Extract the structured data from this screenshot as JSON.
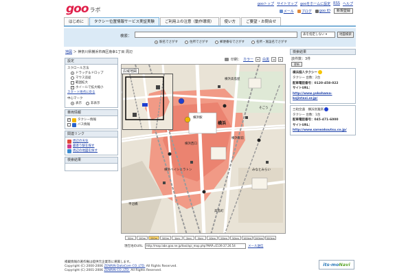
{
  "header": {
    "logo": "goo",
    "logo_sub": "ラボ",
    "top_links": [
      "gooトップ",
      "サイトマップ",
      "gooをホームに設定",
      "RSS",
      "ヘルプ"
    ],
    "tools": [
      "メール",
      "ブログ",
      "goo ID"
    ],
    "signup_label": "新規登録"
  },
  "tabs": [
    "はじめに",
    "タクシー位置情報サービス実証実験",
    "ご利用上の注意（動作環境）",
    "使い方",
    "ご要望・お問合せ"
  ],
  "search": {
    "label": "検索：",
    "value": "",
    "select_value": "表を指定しない",
    "button_label": "地図検索",
    "options": [
      "駅名でさがす",
      "住所でさがす",
      "郵便番号でさがす",
      "名所・施設名でさがす"
    ]
  },
  "breadcrumb": {
    "link": "地図",
    "sep": "＞",
    "current": "神奈川県横浜市西区南幸1丁目 周辺"
  },
  "settings": {
    "title": "設定",
    "scroll_method": "スクロール方法",
    "scroll_options": [
      "ドラッグ＆ドロップ",
      "マウス追従"
    ],
    "zoom_options": [
      "範囲拡大",
      "ホイールで拡大縮小"
    ],
    "start_link": "スタート地点に戻る",
    "center_mark": "中心マーク",
    "center_options": [
      "表示",
      "非表示"
    ]
  },
  "vehicle": {
    "title": "車両情報",
    "items": [
      "タクシー情報",
      "バス情報"
    ]
  },
  "links": {
    "title": "関連リンク",
    "items": [
      "周辺の天気",
      "最寄り駅を探す",
      "周辺の地図を探す"
    ]
  },
  "results_left": {
    "title": "検索結果"
  },
  "map": {
    "overview_title": "広域地図",
    "print_label": "印刷：",
    "color_link": "カラー",
    "mono_link": "白黒",
    "scale_labels": [
      "50m",
      "100m",
      "200m",
      "500m",
      "1km",
      "2km",
      "5km",
      "10km",
      "20km",
      "50km",
      "100km",
      "200km",
      "500km"
    ],
    "scale_selected": "200m",
    "url_label": "現在地のURL",
    "url_value": "http://map.labs.goo.ne.jp/taxi/api_map.php?MAP=E139.37.26.54",
    "mail_link": "メール送信",
    "labels": [
      "横浜",
      "横浜駅",
      "横浜西口",
      "横浜高島屋",
      "横浜駅前",
      "横浜ベイシェラトン",
      "そごう",
      "平沼橋",
      "みなとみらい",
      "高島町"
    ]
  },
  "results": {
    "title": "検索結果",
    "count": "該件数：3件",
    "update_label": "更新",
    "cards": [
      {
        "name": "横浜個人タクシー",
        "dot_color": "#f5c400",
        "status": "タクシー 台数：2台",
        "phone": "配車電話番号：0120-458-022",
        "site_label": "サイトURL：",
        "site_url": "http://www.yokohama-kojintaxi.or.jp/"
      },
      {
        "name": "三和交通　横浜営業所",
        "dot_color": "#1f3fd0",
        "status": "タクシー 台数：1台",
        "phone": "配車電話番号：045-471-6000",
        "site_label": "サイトURL：",
        "site_url": "http://www.sanwakoutsu.co.jp/"
      }
    ]
  },
  "footer": {
    "line1": "掲載情報の著作権は提供元企業等に帰属します。",
    "line2_prefix": "Copyright (C) 2000-2006 ",
    "line2_link": "ZENRIN DataCom CO.,LTD.",
    "line2_suffix": " All Rights Reserved.",
    "line3_prefix": "Copyright (C) 2001-2006 ",
    "line3_link": "ZENRIN CO.,LTD.",
    "line3_suffix": " All Rights Reserved.",
    "brand_a": "its-mo",
    "brand_b": "Navi"
  }
}
